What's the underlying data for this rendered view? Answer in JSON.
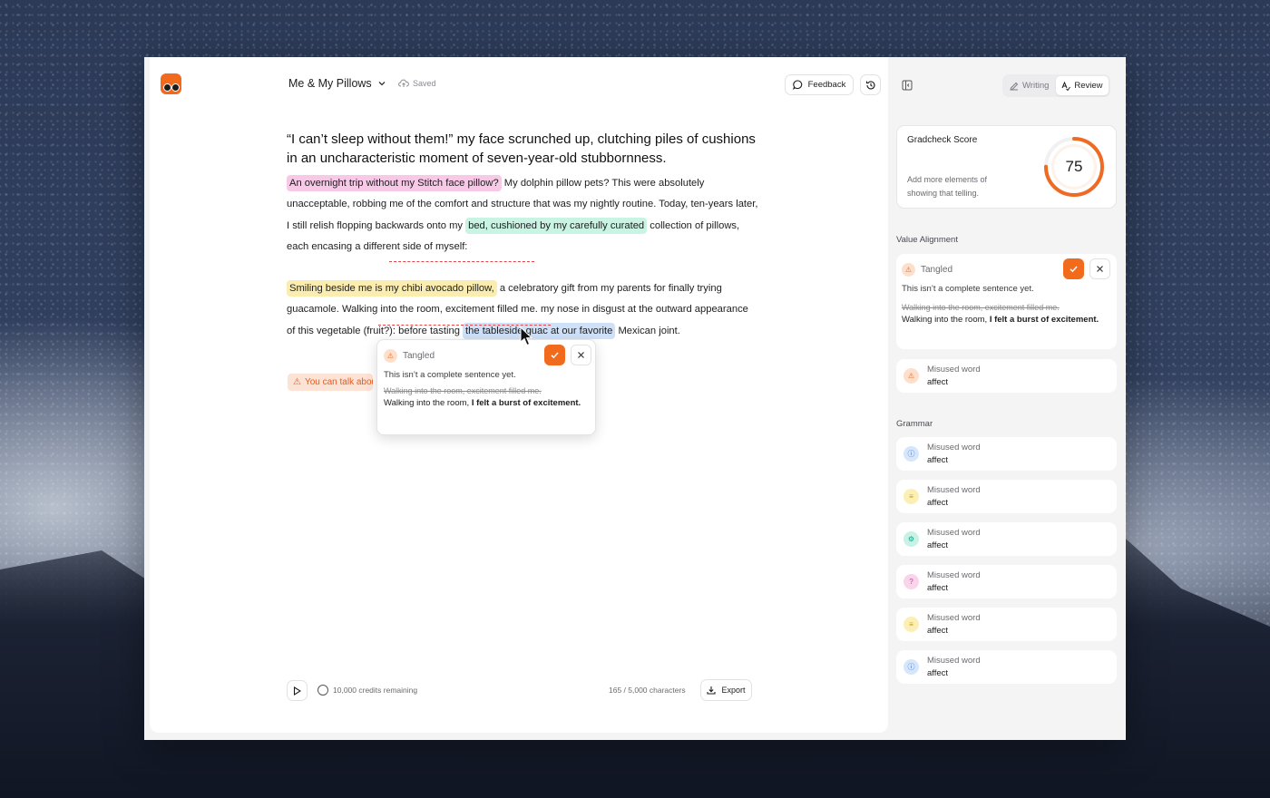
{
  "app": {
    "doc_title": "Me & My Pillows",
    "save_status": "Saved",
    "feedback_label": "Feedback"
  },
  "essay": {
    "heading": "“I can’t sleep without them!” my face scrunched up, clutching piles of cushions in an uncharacteristic moment of seven-year-old stubbornness.",
    "p1": {
      "hl1": "An overnight trip without my Stitch face pillow?",
      "t1": " My dolphin pillow pets?  This were absolutely unacceptable, robbing me of the comfort and structure that was my nightly routine. Today, ten-years later, I still relish flopping backwards onto my ",
      "hl2": "bed, cushioned by my carefully curated",
      "t2": " collection of pillows, each encasing a different side of myself:"
    },
    "p2": {
      "hl1": "Smiling beside me is my chibi avocado pillow,",
      "t1": " a celebratory gift from my parents for finally trying guacamole. Walking into the room, excitement filled me. my nose in disgust at the outward appearance of this vegetable (fruit?): before tasting ",
      "hl2": "the tableside guac at our favorite",
      "t2": " Mexican joint."
    },
    "warning_chip": "You can talk about"
  },
  "popover": {
    "category": "Tangled",
    "message": "This isn’t a complete sentence yet.",
    "original": "Walking into the room, excitement filled me.",
    "suggestion_prefix": "Walking into the room, ",
    "suggestion_bold": "I felt a burst of excitement."
  },
  "footer": {
    "credits": "10,000 credits remaining",
    "char_count": "165 / 5,000 characters",
    "export_label": "Export"
  },
  "panel": {
    "tabs": [
      {
        "label": "Writing",
        "active": false
      },
      {
        "label": "Review",
        "active": true
      }
    ],
    "score": {
      "title": "Gradcheck Score",
      "value": 75,
      "max": 100,
      "hint": "Add more elements of showing that telling."
    },
    "value_alignment": {
      "label": "Value Alignment",
      "card": {
        "category": "Tangled",
        "message": "This isn’t a complete sentence yet.",
        "original": "Walking into the room, excitement filled me.",
        "suggestion_prefix": "Walking into the room, ",
        "suggestion_bold": "I felt a burst of excitement."
      },
      "issue": {
        "title": "Misused word",
        "word": "affect",
        "icon": "warning-icon",
        "color": "#fde0cc"
      }
    },
    "grammar": {
      "label": "Grammar",
      "items": [
        {
          "title": "Misused word",
          "word": "affect",
          "icon": "info-icon",
          "color": "#d6e6fb"
        },
        {
          "title": "Misused word",
          "word": "affect",
          "icon": "lines-icon",
          "color": "#fcefb6"
        },
        {
          "title": "Misused word",
          "word": "affect",
          "icon": "gear-icon",
          "color": "#c9f1e6"
        },
        {
          "title": "Misused word",
          "word": "affect",
          "icon": "question-icon",
          "color": "#f9d4ea"
        },
        {
          "title": "Misused word",
          "word": "affect",
          "icon": "lines-icon",
          "color": "#fcefb6"
        },
        {
          "title": "Misused word",
          "word": "affect",
          "icon": "info-icon",
          "color": "#d6e6fb"
        }
      ]
    }
  },
  "colors": {
    "accent": "#f26a1b",
    "highlight_pink": "#f8c9e6",
    "highlight_green": "#c9f3e3",
    "highlight_yellow": "#fbedb0",
    "highlight_blue": "#cfe1f8",
    "error_underline": "#e2464a"
  }
}
